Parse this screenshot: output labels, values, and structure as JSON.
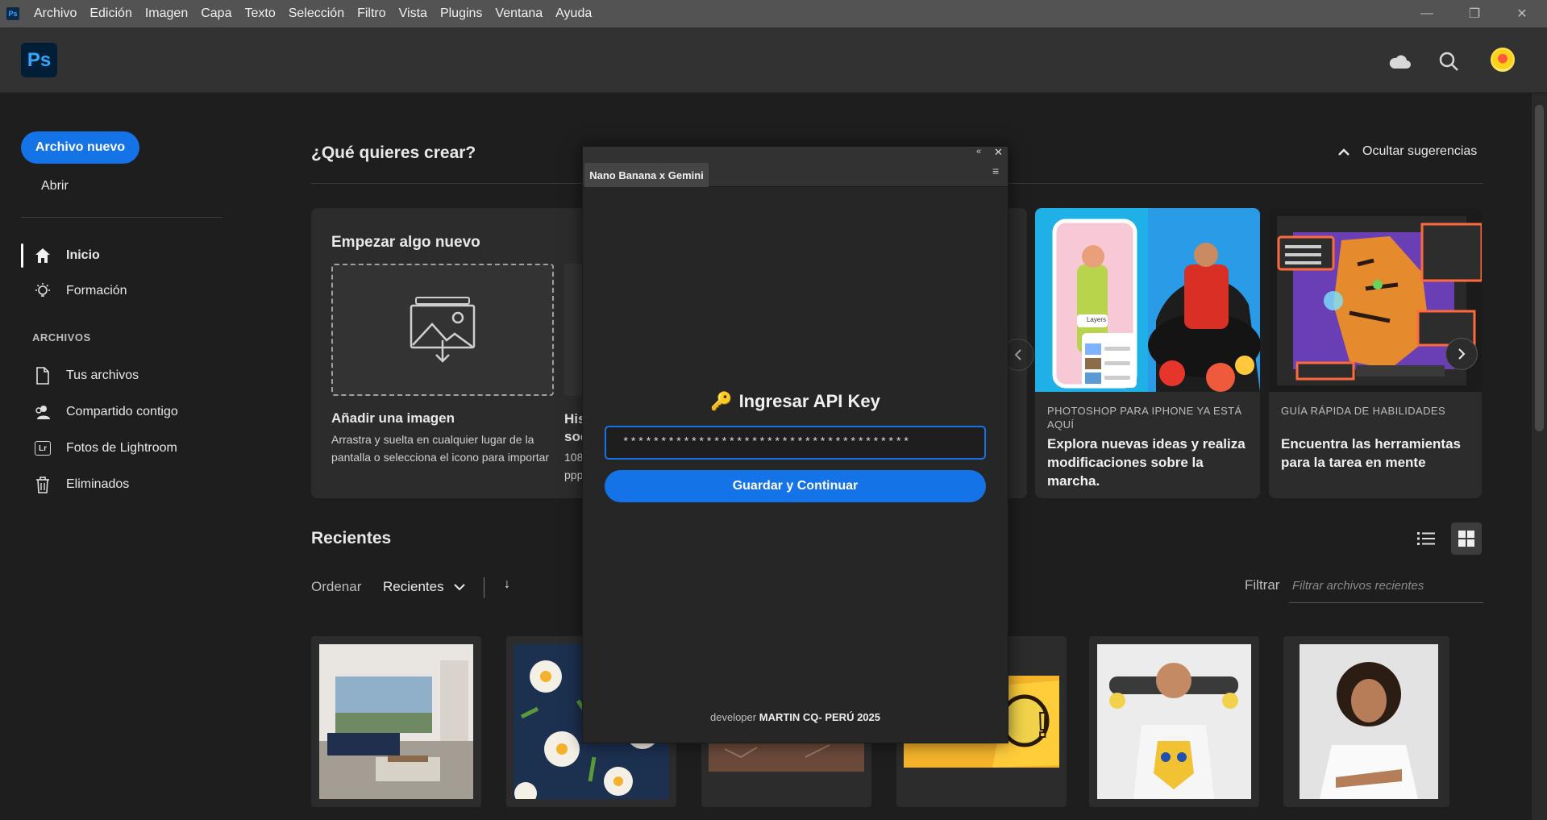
{
  "menu": [
    "Archivo",
    "Edición",
    "Imagen",
    "Capa",
    "Texto",
    "Selección",
    "Filtro",
    "Vista",
    "Plugins",
    "Ventana",
    "Ayuda"
  ],
  "app": {
    "logo": "Ps",
    "mini_logo": "Ps"
  },
  "window_controls": {
    "minimize": "—",
    "maximize": "❐",
    "close": "✕"
  },
  "header_icons": [
    "cloud-icon",
    "search-icon",
    "avatar"
  ],
  "sidebar": {
    "new_file": "Archivo nuevo",
    "open": "Abrir",
    "nav": [
      {
        "label": "Inicio",
        "icon": "home-icon"
      },
      {
        "label": "Formación",
        "icon": "lightbulb-icon"
      }
    ],
    "section_title": "ARCHIVOS",
    "files": [
      {
        "label": "Tus archivos",
        "icon": "document-icon"
      },
      {
        "label": "Compartido contigo",
        "icon": "shared-user-icon"
      },
      {
        "label": "Fotos de Lightroom",
        "icon": "lightroom-icon",
        "badge": "Lr"
      },
      {
        "label": "Eliminados",
        "icon": "trash-icon"
      }
    ]
  },
  "main": {
    "question": "¿Qué quieres crear?",
    "hide_suggestions": "Ocultar sugerencias",
    "start_card": {
      "title": "Empezar algo nuevo",
      "add_title": "Añadir una imagen",
      "add_desc": "Arrastra y suelta en cualquier lugar de la pantalla o selecciona el icono para importar",
      "second_title_partial": "His soc",
      "second_desc_partial": "108 ppp"
    },
    "promos": [
      {
        "kicker": "PHOTOSHOP PARA IPHONE YA ESTÁ AQUÍ",
        "title": "Explora nuevas ideas y realiza modificaciones sobre la marcha.",
        "badge": "Layers"
      },
      {
        "kicker": "GUÍA RÁPIDA DE HABILIDADES",
        "title": "Encuentra las herramientas para la tarea en mente"
      }
    ],
    "recents": {
      "title": "Recientes",
      "sort_label": "Ordenar",
      "sort_value": "Recientes",
      "sort_dir": "↓",
      "filter_label": "Filtrar",
      "filter_placeholder": "Filtrar archivos recientes"
    }
  },
  "plugin_panel": {
    "tab": "Nano Banana x Gemini",
    "collapse": "«",
    "close": "✕",
    "menu": "≡",
    "api_title": "Ingresar API Key",
    "key_emoji": "🔑",
    "api_value": "**************************************",
    "save_button": "Guardar y Continuar",
    "credit_prefix": "developer",
    "credit_name": "MARTIN CQ- PERÚ 2025"
  },
  "colors": {
    "accent": "#1473e6",
    "bg": "#1e1e1e",
    "card": "#2c2c2c",
    "menubar": "#535353"
  }
}
